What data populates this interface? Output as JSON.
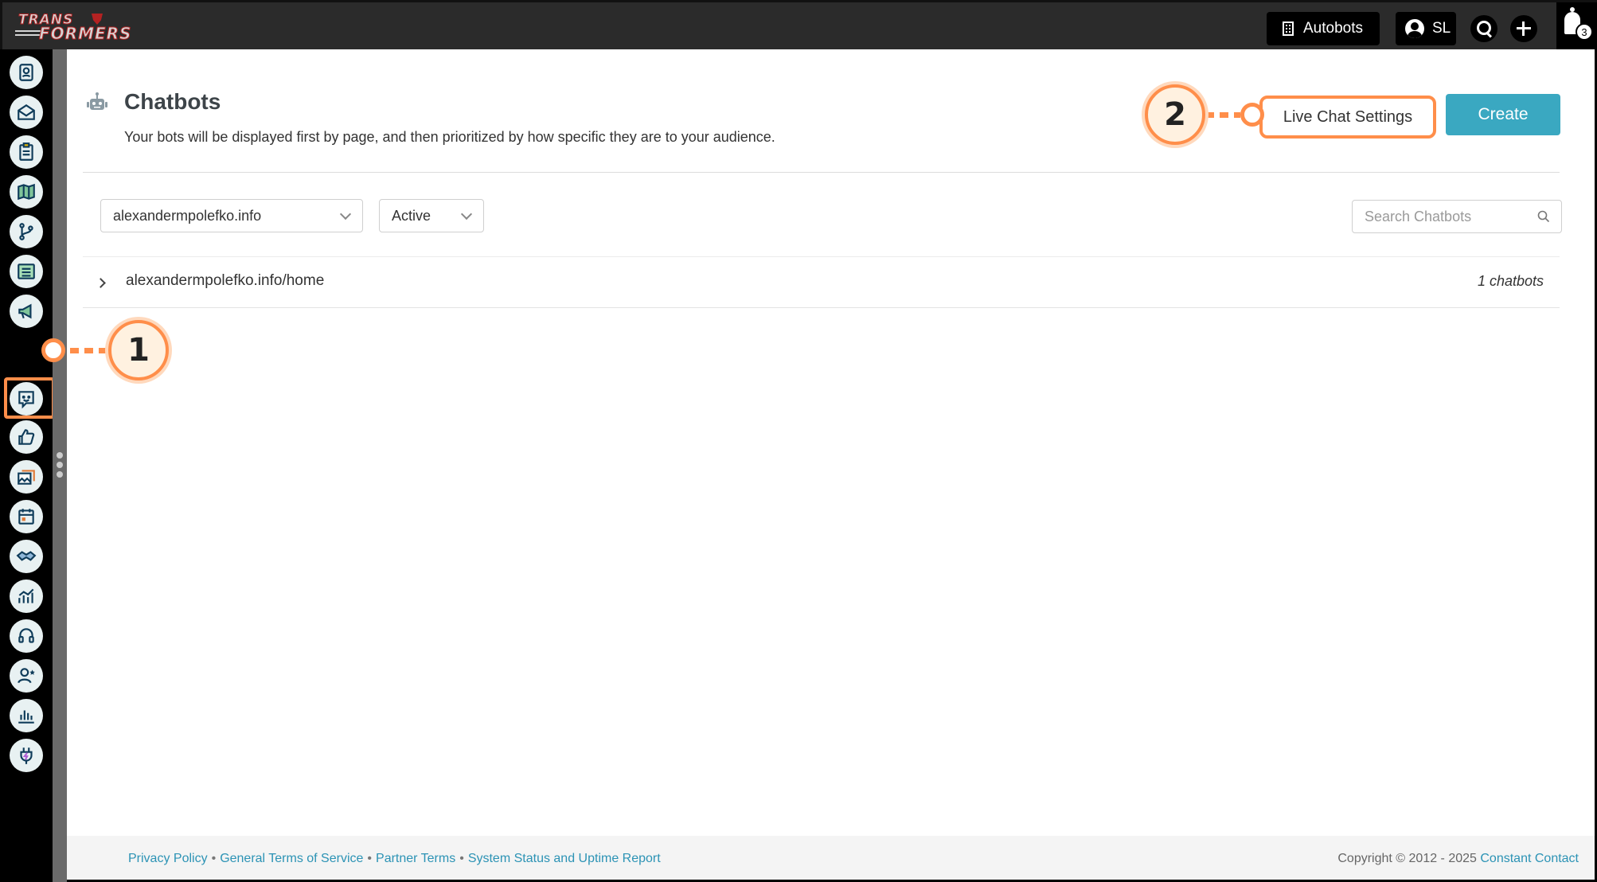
{
  "topbar": {
    "logo_text_line1": "TRANS",
    "logo_text_line2": "FORMERS",
    "account_label": "Autobots",
    "user_initials": "SL",
    "notification_count": "3"
  },
  "sidebar": {
    "items": [
      {
        "icon": "contacts-icon"
      },
      {
        "icon": "email-icon"
      },
      {
        "icon": "clipboard-icon"
      },
      {
        "icon": "map-icon"
      },
      {
        "icon": "workflow-icon"
      },
      {
        "icon": "list-icon"
      },
      {
        "icon": "megaphone-icon"
      },
      {
        "icon": "chatbot-icon",
        "active": true
      },
      {
        "icon": "thumbs-up-icon"
      },
      {
        "icon": "media-icon"
      },
      {
        "icon": "calendar-icon"
      },
      {
        "icon": "handshake-icon"
      },
      {
        "icon": "analytics-icon"
      },
      {
        "icon": "headset-icon"
      },
      {
        "icon": "user-star-icon"
      },
      {
        "icon": "bar-chart-icon"
      },
      {
        "icon": "plug-icon"
      }
    ]
  },
  "page": {
    "title": "Chatbots",
    "subtitle": "Your bots will be displayed first by page, and then prioritized by how specific they are to your audience.",
    "live_chat_settings_label": "Live Chat Settings",
    "create_label": "Create"
  },
  "filters": {
    "site_value": "alexandermpolefko.info",
    "status_value": "Active",
    "search_placeholder": "Search Chatbots"
  },
  "list": {
    "rows": [
      {
        "page": "alexandermpolefko.info/home",
        "count": "1 chatbots"
      }
    ]
  },
  "footer": {
    "links": [
      "Privacy Policy",
      "General Terms of Service",
      "Partner Terms",
      "System Status and Uptime Report"
    ],
    "separator": "•",
    "copyright": "Copyright © 2012 - 2025",
    "company": "Constant Contact"
  },
  "annotations": {
    "callout_1": "1",
    "callout_2": "2"
  },
  "colors": {
    "accent": "#3aa8c1",
    "highlight": "#ff8e4a",
    "topbar": "#2b2b2b",
    "link": "#2c93b5"
  }
}
